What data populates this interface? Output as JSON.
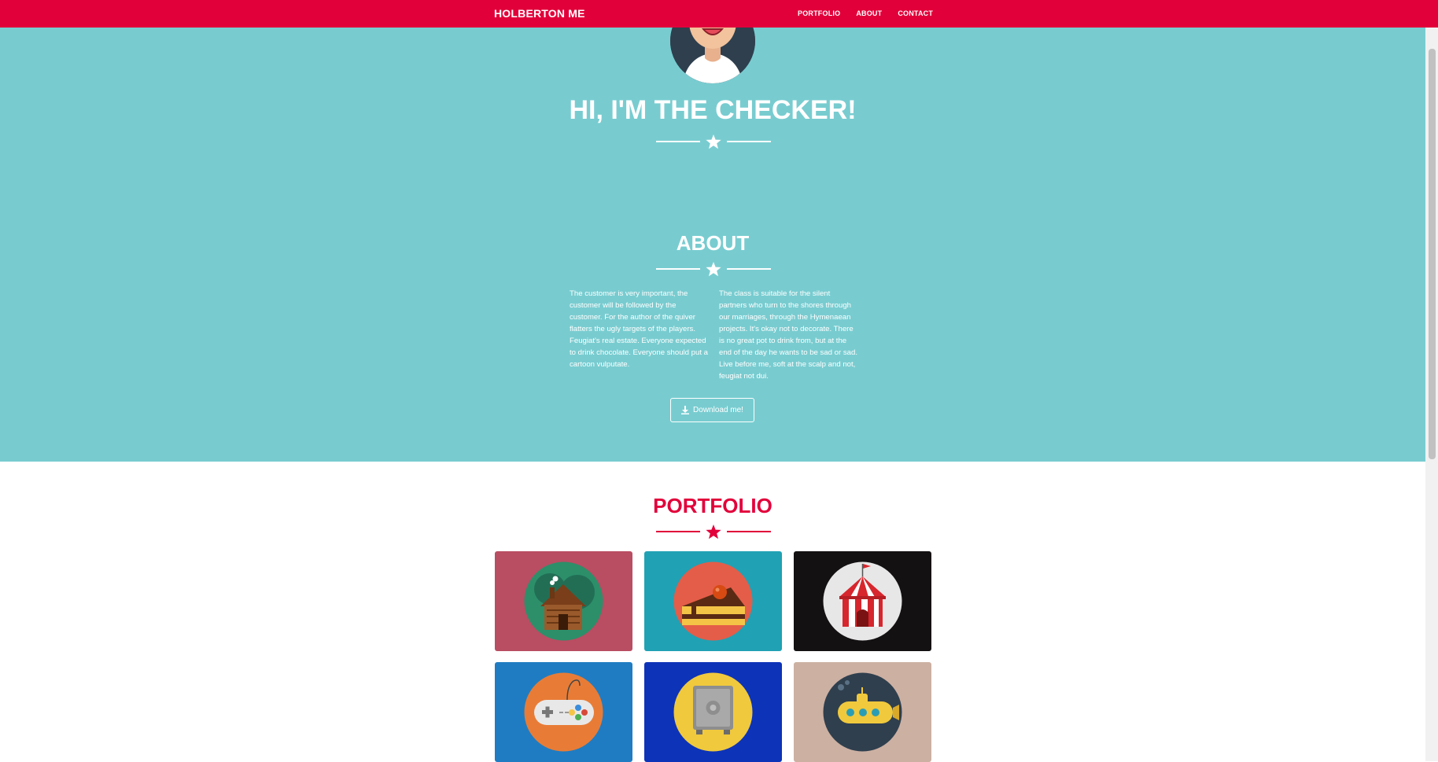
{
  "navbar": {
    "brand": "HOLBERTON ME",
    "links": [
      "PORTFOLIO",
      "ABOUT",
      "CONTACT"
    ],
    "color": "#e2003a"
  },
  "hero": {
    "title": "HI, I'M THE CHECKER!",
    "background": "#78ccd0"
  },
  "about": {
    "title": "ABOUT",
    "paragraphs": [
      "The customer is very important, the customer will be followed by the customer. For the author of the quiver flatters the ugly targets of the players. Feugiat's real estate. Everyone expected to drink chocolate. Everyone should put a cartoon vulputate.",
      "The class is suitable for the silent partners who turn to the shores through our marriages, through the Hymenaean projects. It's okay not to decorate. There is no great pot to drink from, but at the end of the day he wants to be sad or sad. Live before me, soft at the scalp and not, feugiat not dui."
    ],
    "download_label": "Download me!"
  },
  "portfolio": {
    "title": "PORTFOLIO",
    "items": [
      {
        "icon": "cabin-icon",
        "background": "#b94d62"
      },
      {
        "icon": "cake-icon",
        "background": "#20a1b4"
      },
      {
        "icon": "circus-tent-icon",
        "background": "#141112"
      },
      {
        "icon": "game-controller-icon",
        "background": "#1f7cc2"
      },
      {
        "icon": "safe-icon",
        "background": "#0d33b8"
      },
      {
        "icon": "submarine-icon",
        "background": "#ccb0a2"
      }
    ]
  }
}
